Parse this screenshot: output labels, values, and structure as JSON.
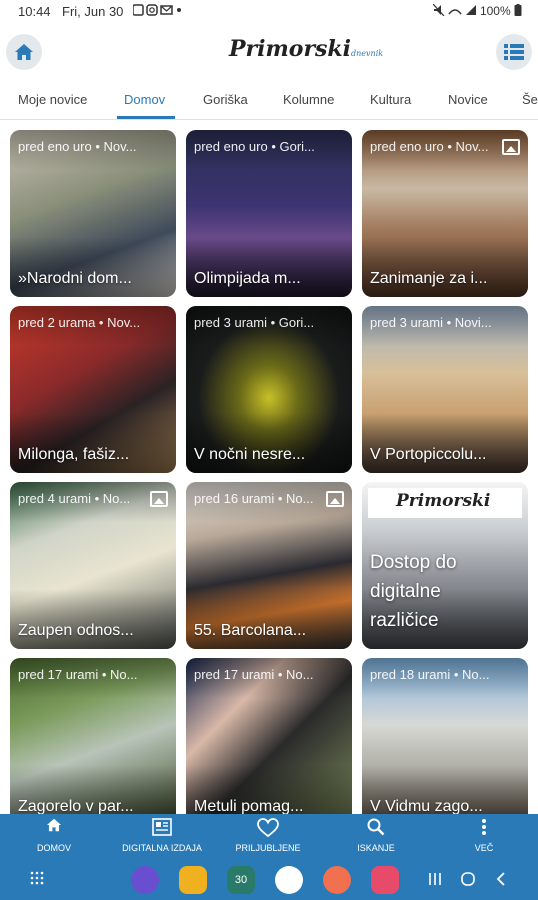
{
  "status": {
    "time": "10:44",
    "date": "Fri, Jun 30",
    "icons": [
      "gallery-icon",
      "instagram-icon",
      "mail-icon",
      "dot-icon"
    ],
    "battery": "100%"
  },
  "appbar": {
    "logo": "Primorski",
    "logo_sub": "dnevnik"
  },
  "tabs": [
    {
      "label": "Moje novice"
    },
    {
      "label": "Domov"
    },
    {
      "label": "Goriška"
    },
    {
      "label": "Kolumne"
    },
    {
      "label": "Kultura"
    },
    {
      "label": "Novice"
    },
    {
      "label": "Še"
    }
  ],
  "active_tab": "Domov",
  "cards": [
    {
      "meta": "pred eno uro • Nov...",
      "title": "»Narodni dom...",
      "gallery": false
    },
    {
      "meta": "pred eno uro • Gori...",
      "title": "Olimpijada m...",
      "gallery": false
    },
    {
      "meta": "pred eno uro • Nov...",
      "title": "Zanimanje za i...",
      "gallery": true
    },
    {
      "meta": "pred 2 urama • Nov...",
      "title": "Milonga, fašiz...",
      "gallery": false
    },
    {
      "meta": "pred 3 urami • Gori...",
      "title": "V nočni nesre...",
      "gallery": false
    },
    {
      "meta": "pred 3 urami • Novi...",
      "title": "V Portopiccolu...",
      "gallery": false
    },
    {
      "meta": "pred 4 urami • No...",
      "title": "Zaupen odnos...",
      "gallery": true
    },
    {
      "meta": "pred 16 urami • No...",
      "title": "55. Barcolana...",
      "gallery": true
    },
    {
      "meta": "",
      "title": "Dostop do digitalne različice",
      "gallery": false,
      "paper": "Primorski"
    },
    {
      "meta": "pred 17 urami • No...",
      "title": "Zagorelo v par...",
      "gallery": false
    },
    {
      "meta": "pred 17 urami • No...",
      "title": "Metuli pomag...",
      "gallery": false
    },
    {
      "meta": "pred 18 urami • No...",
      "title": "V Vidmu zago...",
      "gallery": false
    }
  ],
  "bottom_nav": [
    {
      "label": "DOMOV",
      "icon": "home-icon"
    },
    {
      "label": "DIGITALNA IZDAJA",
      "icon": "newspaper-icon"
    },
    {
      "label": "PRILJUBLJENE",
      "icon": "heart-icon"
    },
    {
      "label": "ISKANJE",
      "icon": "search-icon"
    },
    {
      "label": "VEČ",
      "icon": "more-vertical-icon"
    }
  ],
  "system_bar": {
    "apps": [
      "internet-icon",
      "files-icon",
      "calendar-icon",
      "messages-icon",
      "contacts-icon",
      "screen-recorder-icon"
    ],
    "calendar_day": "30"
  },
  "colors": {
    "accent": "#2a7ab8",
    "tab_active": "#2a7ab8"
  }
}
